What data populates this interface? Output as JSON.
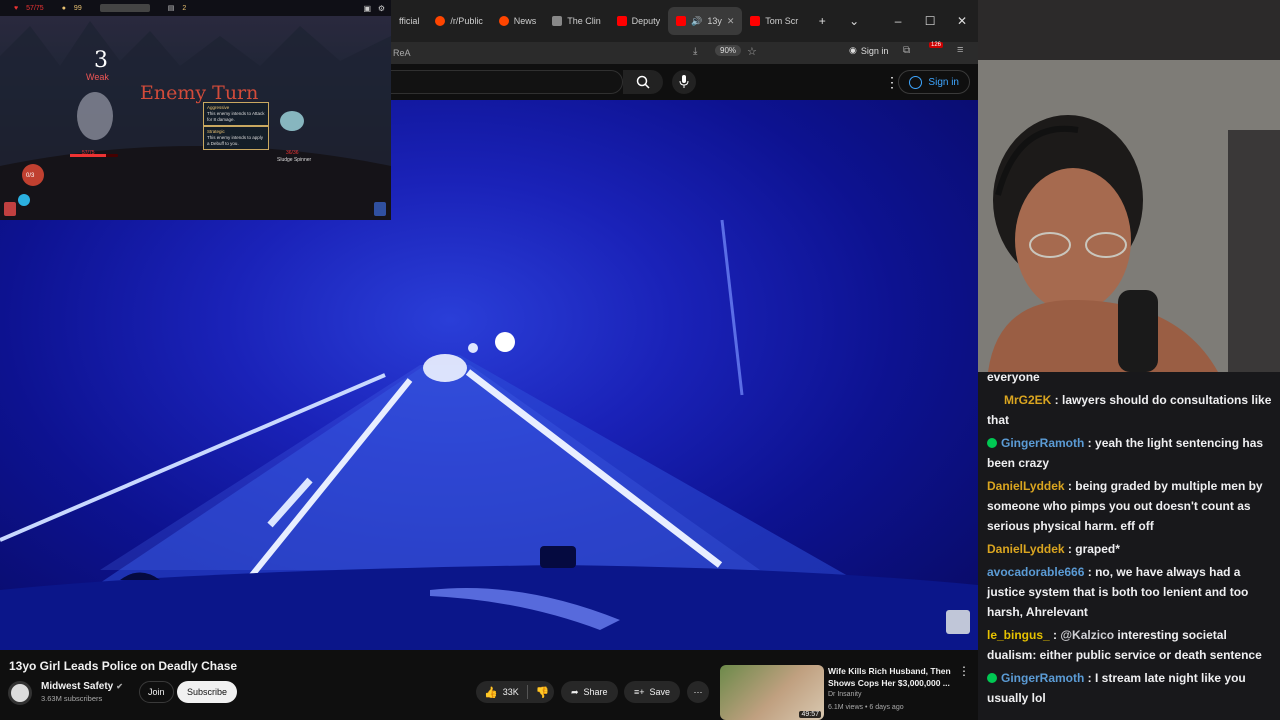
{
  "game": {
    "hud_hp": "57/75",
    "hud_gold": "99",
    "hud_floor": "2",
    "turn_number": "3",
    "status_weak": "Weak",
    "banner": "Enemy Turn",
    "tooltip1_title": "Aggressive",
    "tooltip1_text": "This enemy intends to Attack for 8 damage.",
    "tooltip2_title": "Strategic",
    "tooltip2_text": "This enemy intends to apply a Debuff to you.",
    "player_hp": "57/75",
    "enemy_hp": "36/36",
    "enemy_name": "Sludge Spinner",
    "energy": "0/3"
  },
  "browser": {
    "tabs": [
      {
        "label": "fficial",
        "color": "#ff4500"
      },
      {
        "label": "/r/Public",
        "color": "#ff4500"
      },
      {
        "label": "News",
        "color": "#ff4500"
      },
      {
        "label": "The Clin",
        "color": "#888888"
      },
      {
        "label": "Deputy",
        "color": "#ff0000"
      },
      {
        "label": "13y",
        "color": "#ff0000"
      },
      {
        "label": "Tom Scr",
        "color": "#ff0000"
      }
    ],
    "address_text": "ReA",
    "zoom": "90%",
    "profile_signin": "Sign in",
    "notif_count": "126"
  },
  "youtube": {
    "signin_label": "Sign in",
    "video_title": "13yo Girl Leads Police on Deadly Chase",
    "channel_name": "Midwest Safety",
    "subscribers": "3.63M subscribers",
    "join_label": "Join",
    "subscribe_label": "Subscribe",
    "like_count": "33K",
    "share_label": "Share",
    "save_label": "Save",
    "rec_title": "Wife Kills Rich Husband, Then Shows Cops Her $3,000,000 ...",
    "rec_channel": "Dr Insanity",
    "rec_meta": "6.1M views • 6 days ago",
    "rec_duration": "49:57"
  },
  "chat": {
    "messages": [
      {
        "user": "",
        "color": "#efeff1",
        "text": "everyone",
        "badge": false
      },
      {
        "user": "MrG2EK",
        "color": "#daa520",
        "text": "lawyers should do consultations like that",
        "badge": false
      },
      {
        "user": "GingerRamoth",
        "color": "#5b9bd5",
        "text": "yeah the light sentencing has been crazy",
        "badge": true
      },
      {
        "user": "DanielLyddek",
        "color": "#daa520",
        "text": "being graded by multiple men by someone who pimps you out doesn't count as serious physical harm. eff off",
        "badge": false
      },
      {
        "user": "DanielLyddek",
        "color": "#daa520",
        "text": "graped*",
        "badge": false
      },
      {
        "user": "avocadorable666",
        "color": "#5b9bd5",
        "text": "no, we have always had a justice system that is both too lenient and too harsh, Ahrelevant",
        "badge": false
      },
      {
        "user": "le_bingus_",
        "color": "#e6c200",
        "text": "",
        "mention": "@Kalzico",
        "rest": " interesting societal dualism: either public service or death sentence",
        "badge": false
      },
      {
        "user": "GingerRamoth",
        "color": "#5b9bd5",
        "text": "I stream late night like you usually lol",
        "badge": true
      }
    ]
  }
}
